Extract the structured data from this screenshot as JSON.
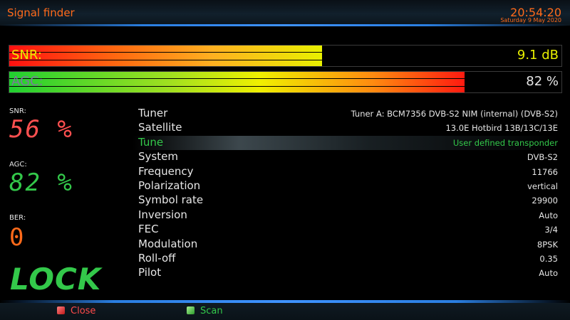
{
  "header": {
    "title": "Signal finder",
    "time": "20:54:20",
    "date": "Saturday  9 May 2020"
  },
  "bars": {
    "snr": {
      "label": "SNR:",
      "value_text": "9.1 dB",
      "fill_fraction": 0.566,
      "label_color": "#e8f000",
      "value_color": "#e8f000"
    },
    "agc": {
      "label": "AGC:",
      "value_text": "82 %",
      "fill_fraction": 0.825,
      "label_color": "#7a7a9a",
      "value_color": "#e6e6e6"
    }
  },
  "stats": {
    "snr": {
      "label": "SNR:",
      "value": "56 %",
      "color": "#ff5050"
    },
    "agc": {
      "label": "AGC:",
      "value": "82 %",
      "color": "#33c84a"
    },
    "ber": {
      "label": "BER:",
      "value": "0",
      "color": "#ff6a1a"
    },
    "lock": "LOCK"
  },
  "info": [
    {
      "label": "Tuner",
      "value": "Tuner A: BCM7356 DVB-S2 NIM (internal) (DVB-S2)",
      "selected": false
    },
    {
      "label": "Satellite",
      "value": "13.0E Hotbird 13B/13C/13E",
      "selected": false
    },
    {
      "label": "Tune",
      "value": "User defined transponder",
      "selected": true
    },
    {
      "label": "System",
      "value": "DVB-S2",
      "selected": false
    },
    {
      "label": "Frequency",
      "value": "11766",
      "selected": false
    },
    {
      "label": "Polarization",
      "value": "vertical",
      "selected": false
    },
    {
      "label": "Symbol rate",
      "value": "29900",
      "selected": false
    },
    {
      "label": "Inversion",
      "value": "Auto",
      "selected": false
    },
    {
      "label": "FEC",
      "value": "3/4",
      "selected": false
    },
    {
      "label": "Modulation",
      "value": "8PSK",
      "selected": false
    },
    {
      "label": "Roll-off",
      "value": "0.35",
      "selected": false
    },
    {
      "label": "Pilot",
      "value": "Auto",
      "selected": false
    }
  ],
  "footer": {
    "close": {
      "label": "Close",
      "icon": "red-key-icon",
      "color": "#ff4a4a"
    },
    "scan": {
      "label": "Scan",
      "icon": "green-key-icon",
      "color": "#33c84a"
    }
  }
}
